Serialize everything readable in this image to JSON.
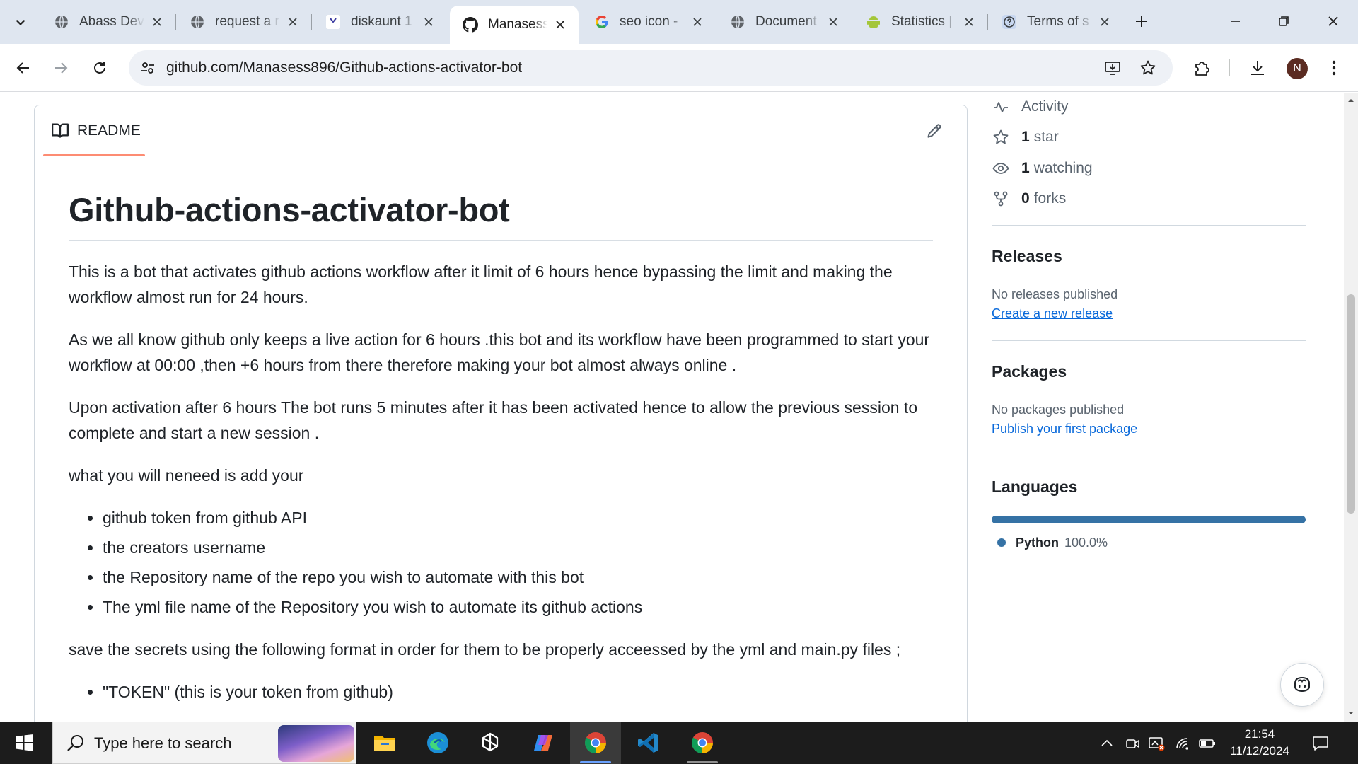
{
  "browser": {
    "tabs": [
      {
        "title": "Abass Dev",
        "icon": "globe-icon"
      },
      {
        "title": "request a r",
        "icon": "globe-icon"
      },
      {
        "title": "diskaunt 1",
        "icon": "diskaunt-icon"
      },
      {
        "title": "Manasess8",
        "icon": "github-icon",
        "active": true
      },
      {
        "title": "seo icon - ",
        "icon": "google-icon"
      },
      {
        "title": "Document",
        "icon": "globe-icon"
      },
      {
        "title": "Statistics |",
        "icon": "android-icon"
      },
      {
        "title": "Terms of s",
        "icon": "help-icon"
      }
    ],
    "url": "github.com/Manasess896/Github-actions-activator-bot",
    "profile_initial": "N"
  },
  "readme": {
    "tab_label": "README",
    "title": "Github-actions-activator-bot",
    "paragraphs": [
      "This is a bot that activates github actions workflow after it limit of 6 hours hence bypassing the limit and making the workflow almost run for 24 hours.",
      "As we all know github only keeps a live action for 6 hours .this bot and its workflow have been programmed to start your workflow at 00:00 ,then +6 hours from there therefore making your bot almost always online .",
      "Upon activation after 6 hours The bot runs 5 minutes after it has been activated hence to allow the previous session to complete and start a new session .",
      "what you will neneed is add your"
    ],
    "requirements": [
      "github token from github API",
      "the creators username",
      "the Repository name of the repo you wish to automate with this bot",
      "The yml file name of the Repository you wish to automate its github actions"
    ],
    "secrets_intro": "save the secrets using the following format in order for them to be properly acceessed by the yml and main.py files ;",
    "secrets": [
      "\"TOKEN\" (this is your token from github)"
    ]
  },
  "sidebar": {
    "activity": "Activity",
    "stars_count": "1",
    "stars_label": "star",
    "watching_count": "1",
    "watching_label": "watching",
    "forks_count": "0",
    "forks_label": "forks",
    "releases": {
      "heading": "Releases",
      "empty": "No releases published",
      "link": "Create a new release"
    },
    "packages": {
      "heading": "Packages",
      "empty": "No packages published",
      "link": "Publish your first package"
    },
    "languages": {
      "heading": "Languages",
      "items": [
        {
          "name": "Python",
          "percent": "100.0%",
          "color": "#3572a5"
        }
      ]
    }
  },
  "taskbar": {
    "search_placeholder": "Type here to search",
    "time": "21:54",
    "date": "11/12/2024"
  },
  "colors": {
    "link": "#0969da",
    "tab_underline": "#fd8c73",
    "python": "#3572a5"
  }
}
